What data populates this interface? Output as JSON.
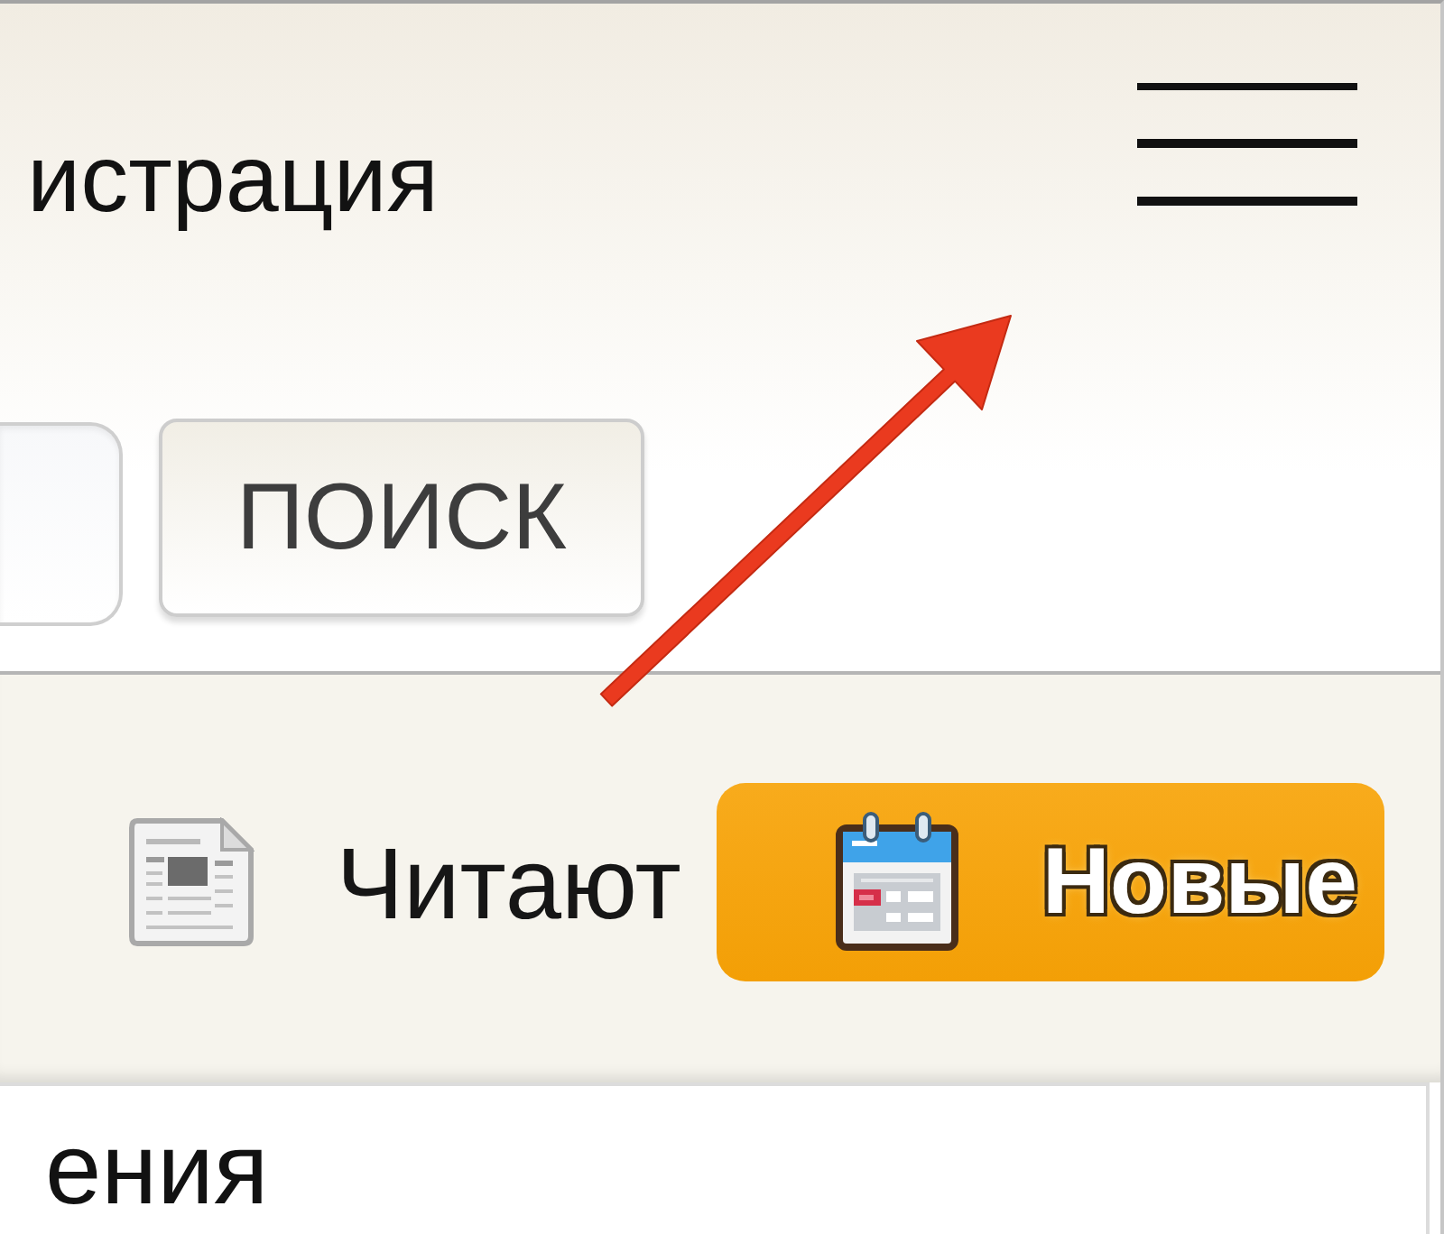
{
  "header": {
    "label": "истрация"
  },
  "search": {
    "button": "ПОИСК"
  },
  "tabs": [
    {
      "label": "Читают",
      "selected": false
    },
    {
      "label": "Новые",
      "selected": true
    }
  ],
  "panel": {
    "heading": "ения"
  }
}
